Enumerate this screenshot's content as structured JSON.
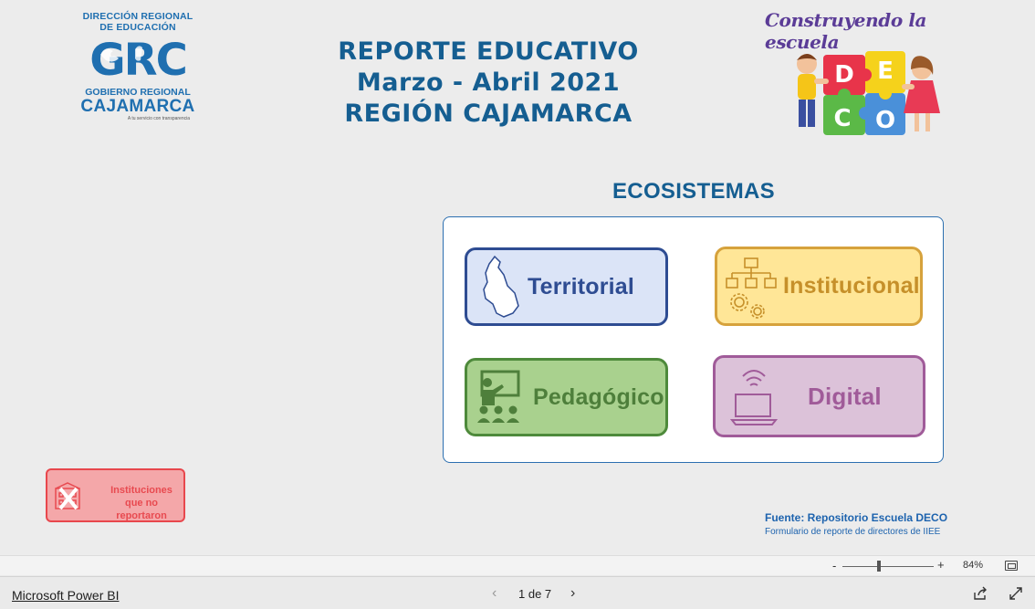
{
  "logo": {
    "line1": "DIRECCIÓN REGIONAL",
    "line2": "DE EDUCACIÓN",
    "mark": "GRC",
    "line3": "GOBIERNO REGIONAL",
    "line4": "CAJAMARCA",
    "tagline": "A tu servicio con transparencia"
  },
  "title": {
    "line1": "REPORTE EDUCATIVO",
    "line2": "Marzo - Abril 2021",
    "line3": "REGIÓN CAJAMARCA"
  },
  "deco": {
    "slogan": "Construyendo la escuela",
    "letters": [
      "D",
      "E",
      "C",
      "O"
    ]
  },
  "ecosistemas": {
    "title": "ECOSISTEMAS",
    "tiles": [
      {
        "label": "Territorial",
        "icon": "map-outline-icon"
      },
      {
        "label": "Institucional",
        "icon": "org-chart-gears-icon"
      },
      {
        "label": "Pedagógico",
        "icon": "teacher-classroom-icon"
      },
      {
        "label": "Digital",
        "icon": "laptop-wifi-icon"
      }
    ]
  },
  "instituciones_button": {
    "line1": "Instituciones",
    "line2": "que no reportaron",
    "icon": "building-x-icon"
  },
  "source": {
    "main": "Fuente: Repositorio Escuela DECO",
    "sub": "Formulario de reporte de directores de IIEE"
  },
  "zoom": {
    "minus": "-",
    "plus": "+",
    "value": "84%",
    "level_percent": 84
  },
  "footer": {
    "app_link": "Microsoft Power BI",
    "page_indicator": "1 de 7",
    "prev": "‹",
    "next": "›"
  },
  "colors": {
    "title_blue": "#155e91",
    "territorial": "#2e4c92",
    "institucional": "#d6a23c",
    "pedagogico": "#4e8a3b",
    "digital": "#a05b99",
    "alert_red": "#e8474d"
  }
}
